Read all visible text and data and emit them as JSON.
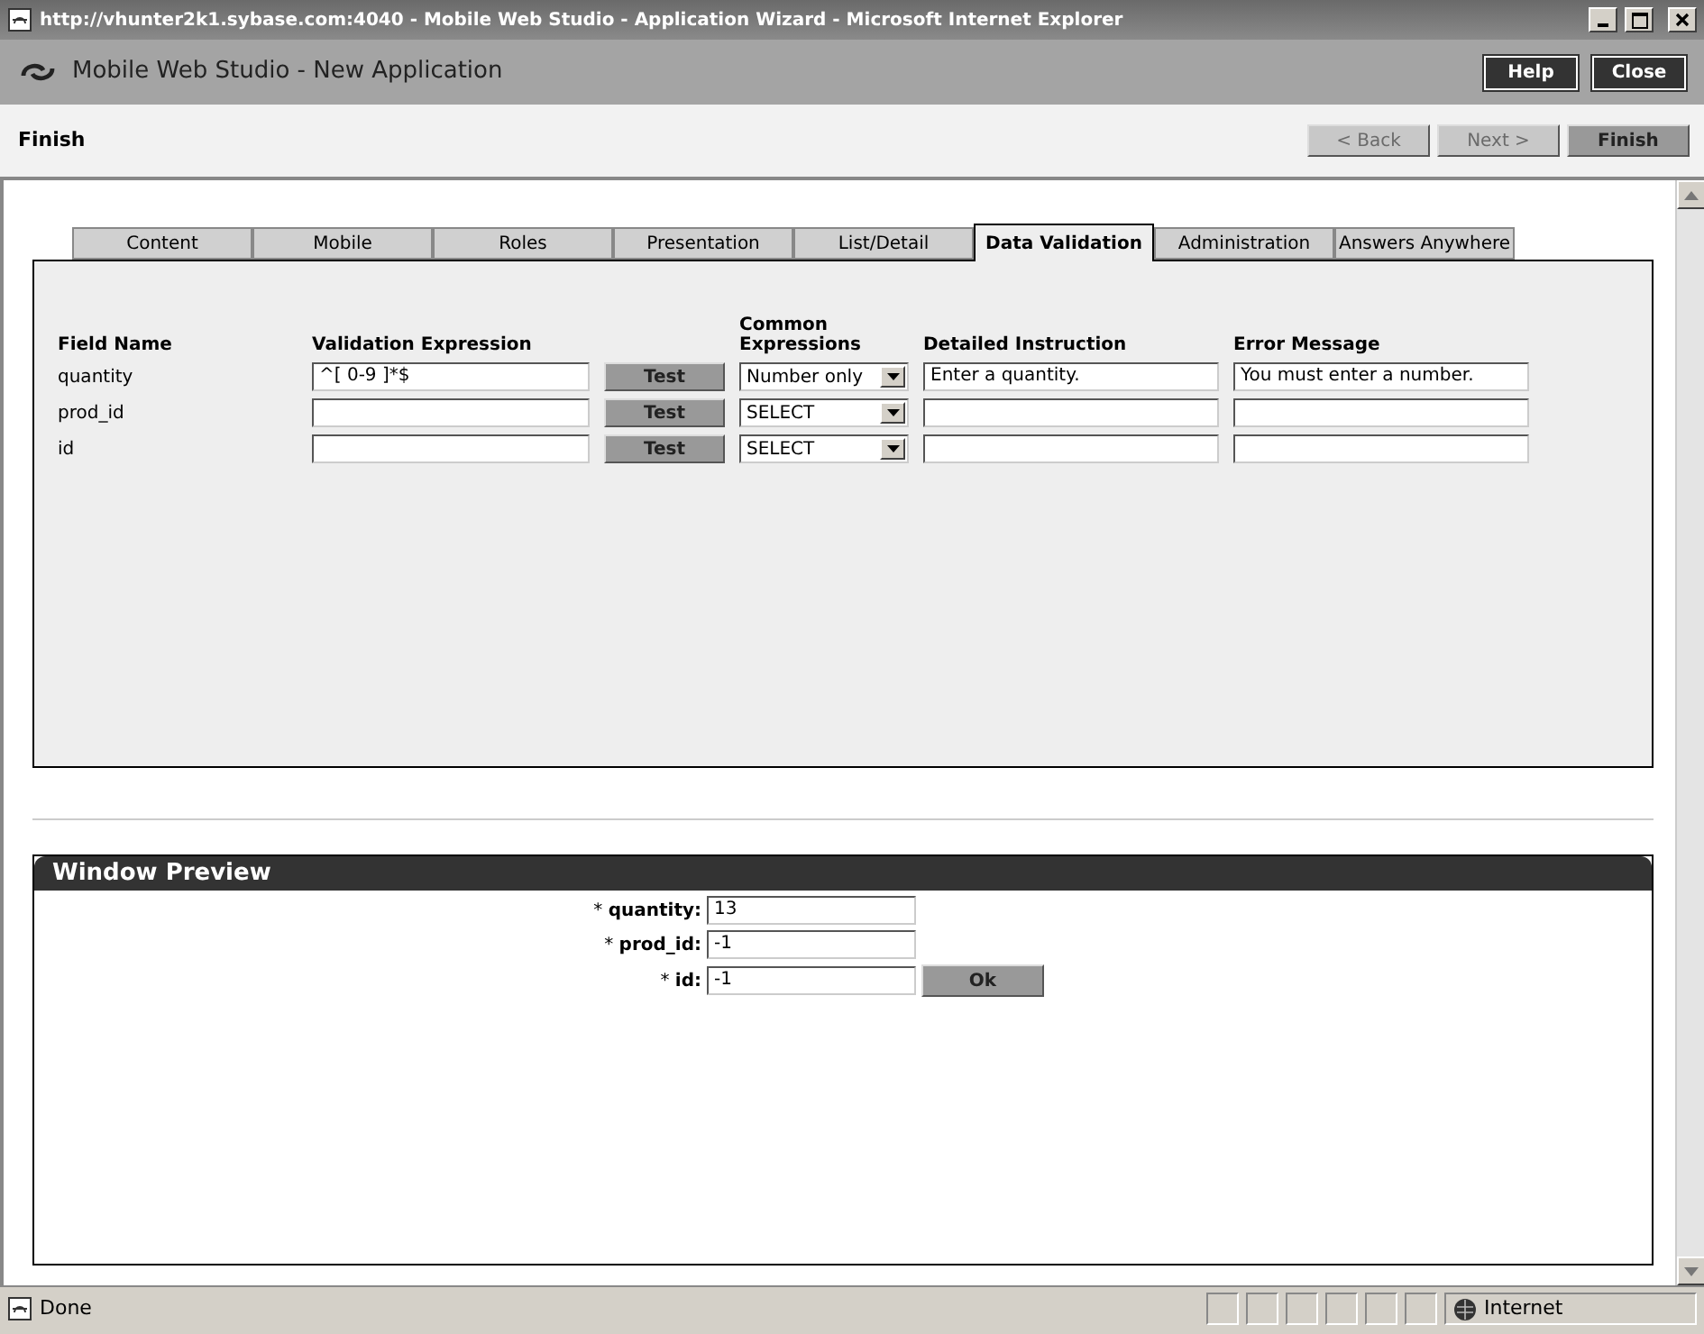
{
  "window": {
    "title": "http://vhunter2k1.sybase.com:4040 - Mobile Web Studio - Application Wizard - Microsoft Internet Explorer"
  },
  "app": {
    "title": "Mobile Web Studio - New Application",
    "buttons": [
      "Help",
      "Close"
    ]
  },
  "wizard": {
    "step": "Finish",
    "nav": [
      {
        "label": "< Back",
        "disabled": true
      },
      {
        "label": "Next >",
        "disabled": true
      },
      {
        "label": "Finish",
        "disabled": false
      }
    ]
  },
  "tabs": [
    {
      "label": "Content",
      "selected": false
    },
    {
      "label": "Mobile",
      "selected": false
    },
    {
      "label": "Roles",
      "selected": false
    },
    {
      "label": "Presentation",
      "selected": false
    },
    {
      "label": "List/Detail",
      "selected": false
    },
    {
      "label": "Data Validation",
      "selected": true
    },
    {
      "label": "Administration",
      "selected": false
    },
    {
      "label": "Answers Anywhere",
      "selected": false
    }
  ],
  "validation": {
    "columns": [
      "Field Name",
      "Validation Expression",
      "Common Expressions",
      "Detailed Instruction",
      "Error Message"
    ],
    "rows": [
      {
        "field": "quantity",
        "expression": "^[ 0-9 ]*$",
        "test": "Test",
        "common": "Number only",
        "instruction": "Enter a quantity.",
        "error": "You must enter a number."
      },
      {
        "field": "prod_id",
        "test": "Test",
        "common": "SELECT"
      },
      {
        "field": "id",
        "test": "Test",
        "common": "SELECT"
      }
    ]
  },
  "preview": {
    "title": "Window Preview",
    "fields": [
      {
        "label": "* **quantity:**",
        "value": "13"
      },
      {
        "label": "* **prod_id:**",
        "value": "-1"
      },
      {
        "label": "* **id:**",
        "value": "-1"
      }
    ],
    "button": "Ok"
  },
  "status_bar": {
    "text": "Done",
    "zone": "Internet"
  }
}
